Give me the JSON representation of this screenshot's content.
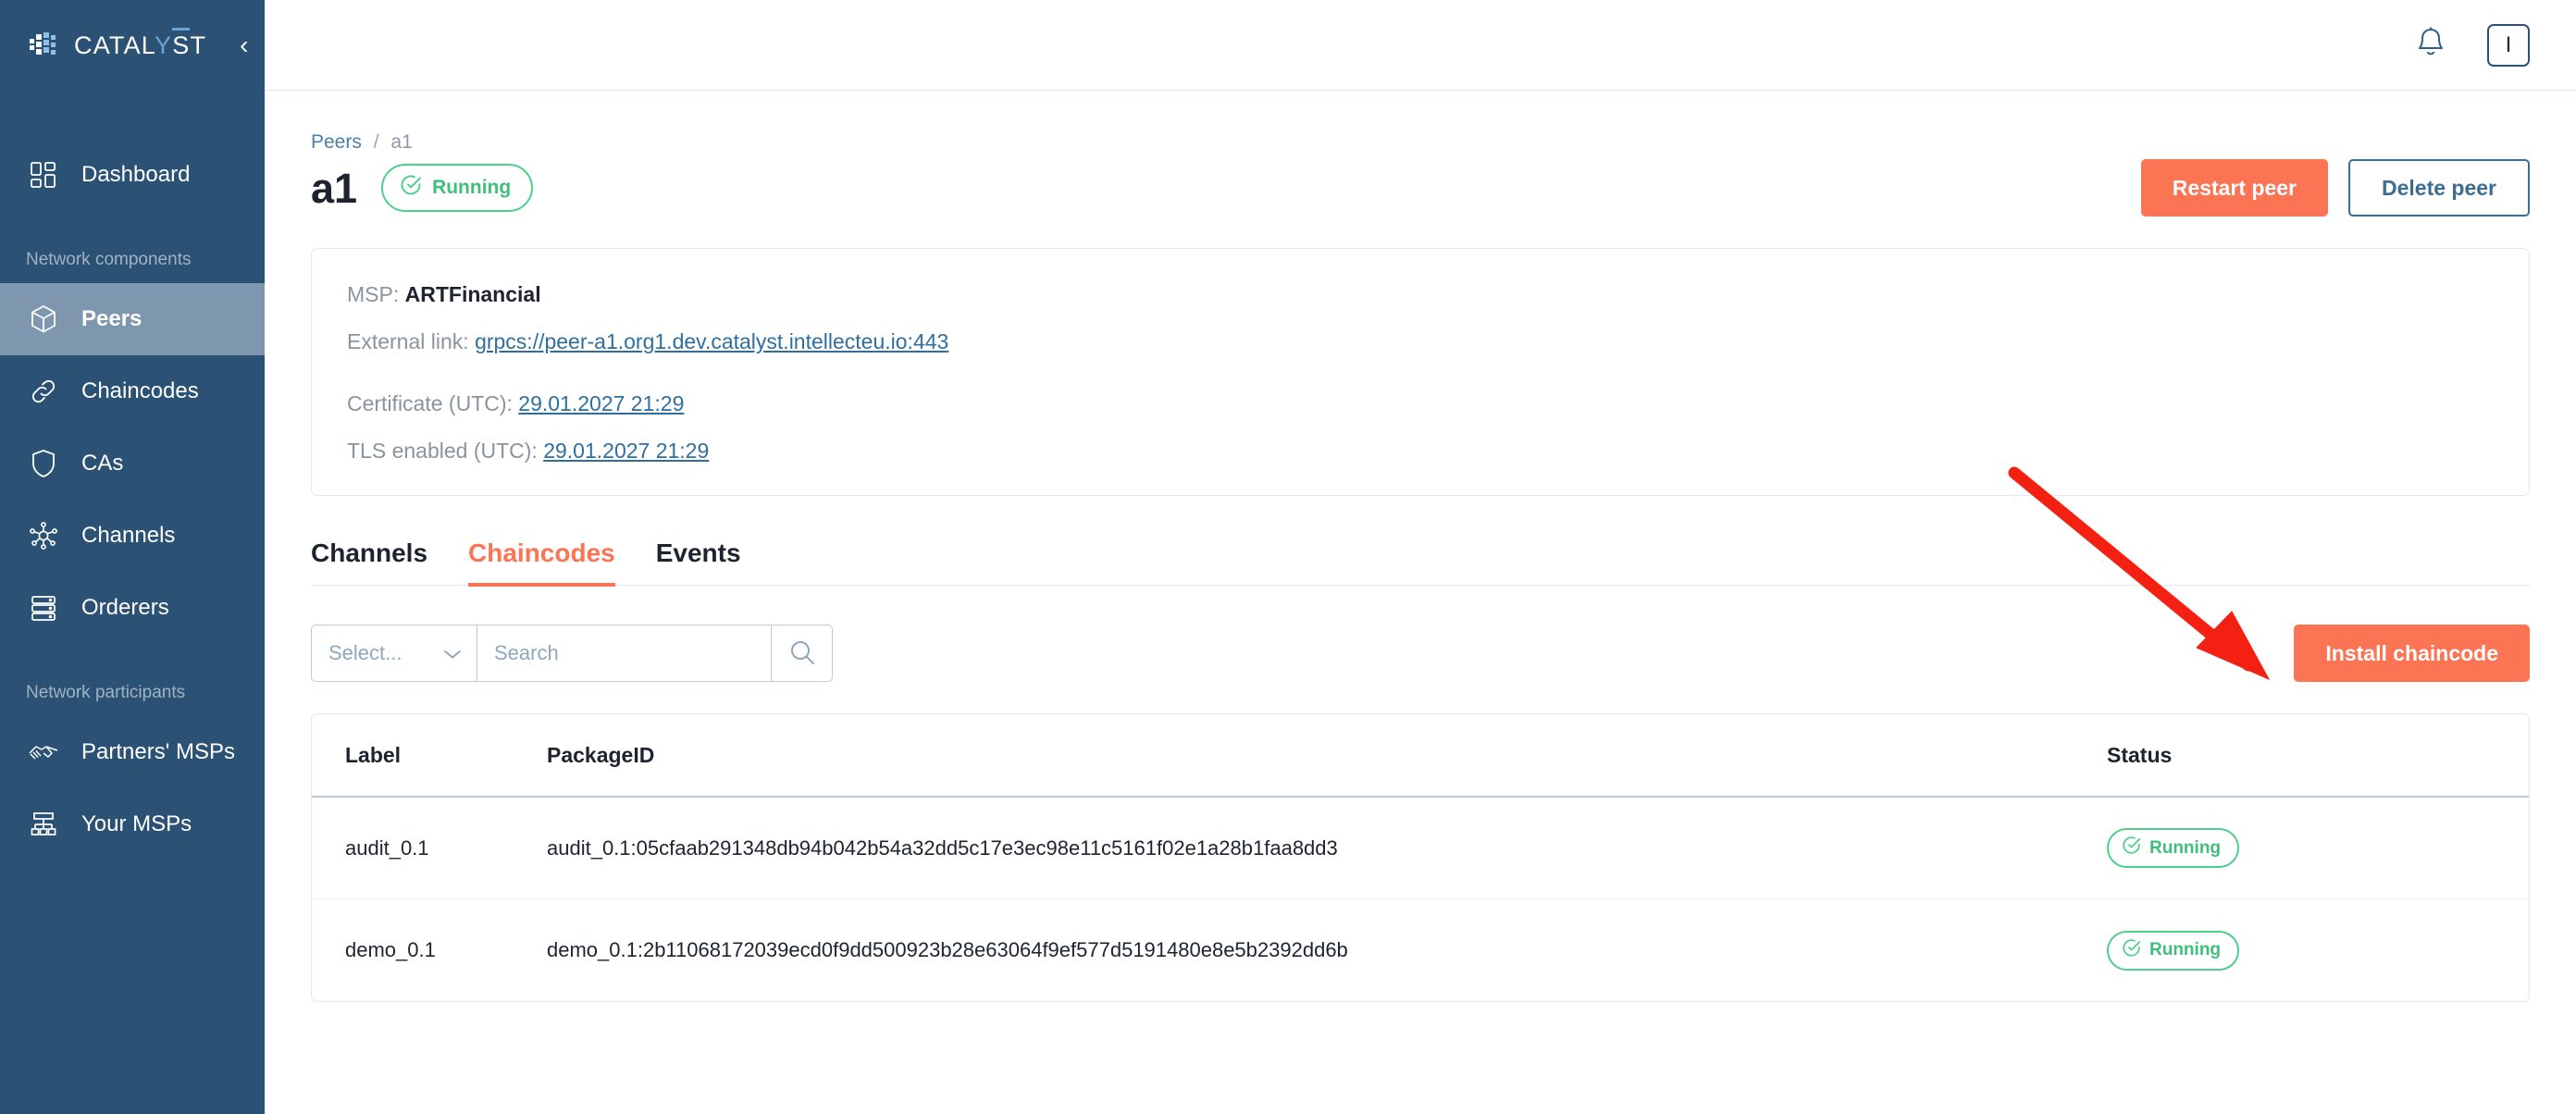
{
  "brand": {
    "name_part1": "CATAL",
    "name_accent": "Y",
    "name_bar": "S",
    "name_part2": "T",
    "collapse_icon": "chevron-left-icon"
  },
  "sidebar": {
    "items": [
      {
        "label": "Dashboard",
        "icon": "dashboard-icon",
        "active": false
      },
      {
        "label": "Peers",
        "icon": "cube-icon",
        "active": true
      },
      {
        "label": "Chaincodes",
        "icon": "link-icon",
        "active": false
      },
      {
        "label": "CAs",
        "icon": "shield-icon",
        "active": false
      },
      {
        "label": "Channels",
        "icon": "network-icon",
        "active": false
      },
      {
        "label": "Orderers",
        "icon": "server-icon",
        "active": false
      },
      {
        "label": "Partners' MSPs",
        "icon": "handshake-icon",
        "active": false
      },
      {
        "label": "Your MSPs",
        "icon": "org-chart-icon",
        "active": false
      }
    ],
    "section_network_components": "Network components",
    "section_network_participants": "Network participants"
  },
  "topbar": {
    "notifications_icon": "bell-icon",
    "avatar_initial": "I"
  },
  "breadcrumb": {
    "parent": "Peers",
    "separator": "/",
    "current": "a1"
  },
  "header": {
    "title": "a1",
    "status": "Running",
    "restart_label": "Restart peer",
    "delete_label": "Delete peer"
  },
  "info": {
    "msp_label": "MSP:",
    "msp_value": "ARTFinancial",
    "external_link_label": "External link:",
    "external_link_value": "grpcs://peer-a1.org1.dev.catalyst.intellecteu.io:443",
    "certificate_label": "Certificate (UTC):",
    "certificate_value": "29.01.2027 21:29",
    "tls_label": "TLS enabled (UTC):",
    "tls_value": "29.01.2027 21:29"
  },
  "tabs": [
    {
      "label": "Channels",
      "active": false
    },
    {
      "label": "Chaincodes",
      "active": true
    },
    {
      "label": "Events",
      "active": false
    }
  ],
  "toolbar": {
    "select_placeholder": "Select...",
    "select_chevron": "chevron-down-icon",
    "search_placeholder": "Search",
    "search_icon": "search-icon",
    "install_label": "Install chaincode"
  },
  "table": {
    "columns": [
      "Label",
      "PackageID",
      "Status"
    ],
    "rows": [
      {
        "label": "audit_0.1",
        "packageid": "audit_0.1:05cfaab291348db94b042b54a32dd5c17e3ec98e11c5161f02e1a28b1faa8dd3",
        "status": "Running"
      },
      {
        "label": "demo_0.1",
        "packageid": "demo_0.1:2b11068172039ecd0f9dd500923b28e63064f9ef577d5191480e8e5b2392dd6b",
        "status": "Running"
      }
    ]
  },
  "colors": {
    "sidebar_bg": "#2b5174",
    "sidebar_active": "#7e97ae",
    "accent_orange": "#fb7454",
    "status_green": "#4ed08a",
    "link_blue": "#2f6f9f",
    "annotation_red": "#f42113"
  }
}
